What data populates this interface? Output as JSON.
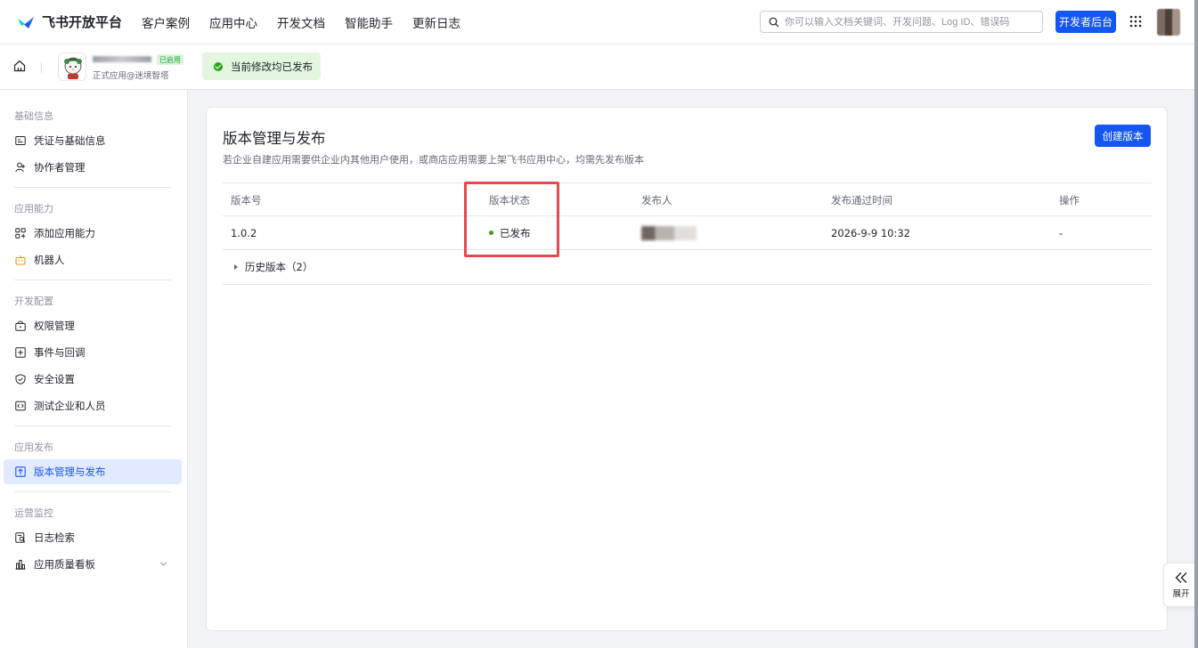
{
  "topnav": {
    "logo_text": "飞书开放平台",
    "links": [
      "客户案例",
      "应用中心",
      "开发文档",
      "智能助手",
      "更新日志"
    ],
    "search_placeholder": "你可以输入文档关键词、开发问题、Log ID、错误码",
    "dev_button": "开发者后台"
  },
  "appbar": {
    "app_enabled_badge": "已启用",
    "app_sub": "正式应用@迷境智塔",
    "publish_status": "当前修改均已发布"
  },
  "sidebar": {
    "groups": [
      {
        "label": "基础信息",
        "items": [
          {
            "label": "凭证与基础信息",
            "icon": "id-card-icon"
          },
          {
            "label": "协作者管理",
            "icon": "user-add-icon"
          }
        ]
      },
      {
        "label": "应用能力",
        "items": [
          {
            "label": "添加应用能力",
            "icon": "grid-add-icon"
          },
          {
            "label": "机器人",
            "icon": "robot-icon"
          }
        ]
      },
      {
        "label": "开发配置",
        "items": [
          {
            "label": "权限管理",
            "icon": "lock-box-icon"
          },
          {
            "label": "事件与回调",
            "icon": "event-icon"
          },
          {
            "label": "安全设置",
            "icon": "shield-icon"
          },
          {
            "label": "测试企业和人员",
            "icon": "code-box-icon"
          }
        ]
      },
      {
        "label": "应用发布",
        "items": [
          {
            "label": "版本管理与发布",
            "icon": "upload-box-icon"
          }
        ]
      },
      {
        "label": "运营监控",
        "items": [
          {
            "label": "日志检索",
            "icon": "log-search-icon"
          },
          {
            "label": "应用质量看板",
            "icon": "bar-chart-icon"
          }
        ]
      }
    ],
    "active": "版本管理与发布"
  },
  "main": {
    "title": "版本管理与发布",
    "description": "若企业自建应用需要供企业内其他用户使用，或商店应用需要上架飞书应用中心，均需先发布版本",
    "create_button": "创建版本",
    "table": {
      "headers": [
        "版本号",
        "版本状态",
        "发布人",
        "发布通过时间",
        "操作"
      ],
      "rows": [
        {
          "version": "1.0.2",
          "status": "已发布",
          "time": "2026-9-9 10:32",
          "action": "-"
        }
      ],
      "history_label": "历史版本（2）"
    }
  },
  "expand_widget": {
    "label": "展开"
  },
  "colors": {
    "accent": "#1456f0",
    "success": "#2ea121",
    "highlight": "#e5484d"
  }
}
